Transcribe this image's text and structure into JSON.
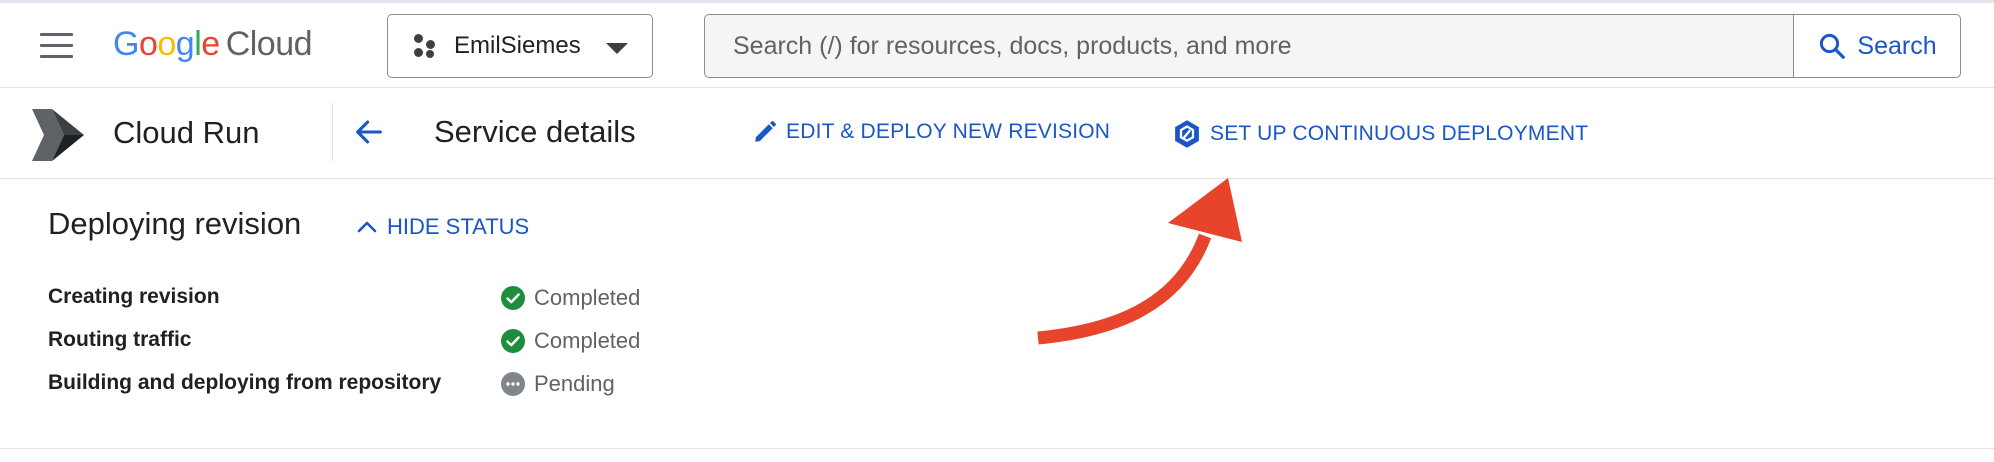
{
  "header": {
    "logo": {
      "google": [
        "G",
        "o",
        "o",
        "g",
        "l",
        "e"
      ],
      "cloud": "Cloud"
    },
    "project": {
      "name": "EmilSiemes"
    },
    "search": {
      "placeholder": "Search (/) for resources, docs, products, and more",
      "button_label": "Search"
    }
  },
  "subheader": {
    "product": "Cloud Run",
    "page_title": "Service details",
    "actions": [
      {
        "label": "EDIT & DEPLOY NEW REVISION",
        "icon": "pencil-icon"
      },
      {
        "label": "SET UP CONTINUOUS DEPLOYMENT",
        "icon": "cloud-build-icon"
      }
    ]
  },
  "status": {
    "title": "Deploying revision",
    "toggle_label": "HIDE STATUS",
    "steps": [
      {
        "label": "Creating revision",
        "state": "Completed",
        "icon": "check-circle-icon"
      },
      {
        "label": "Routing traffic",
        "state": "Completed",
        "icon": "check-circle-icon"
      },
      {
        "label": "Building and deploying from repository",
        "state": "Pending",
        "icon": "pending-icon"
      }
    ]
  },
  "colors": {
    "accent": "#1a56c8",
    "success": "#1e8e3e",
    "pending": "#80868b",
    "annotation_arrow": "#e8432b"
  }
}
